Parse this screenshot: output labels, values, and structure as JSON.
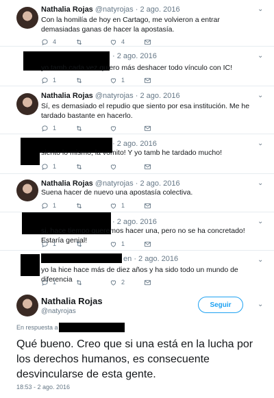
{
  "tweets": [
    {
      "name": "Nathalia Rojas",
      "handle": "@natyrojas",
      "date": "2 ago. 2016",
      "text": "Con la homilía de hoy en Cartago, me volvieron a entrar demasiadas ganas de hacer la apostasía.",
      "replies": "4",
      "retweets": "",
      "likes": "4"
    },
    {
      "name": "",
      "handle": "",
      "date": "2 ago. 2016",
      "text": "yo tamb cada vez quiero más deshacer todo vínculo con IC!",
      "replies": "1",
      "retweets": "",
      "likes": "1"
    },
    {
      "name": "Nathalia Rojas",
      "handle": "@natyrojas",
      "date": "2 ago. 2016",
      "text": "Sí, es demasiado el repudio que siento por esa institución. Me he tardado bastante en hacerlo.",
      "replies": "1",
      "retweets": "",
      "likes": ""
    },
    {
      "name": "",
      "handle": "",
      "date": "2 ago. 2016",
      "text": "siento lo mismo, la vomito! Y yo tamb he tardado mucho!",
      "replies": "1",
      "retweets": "",
      "likes": ""
    },
    {
      "name": "Nathalia Rojas",
      "handle": "@natyrojas",
      "date": "2 ago. 2016",
      "text": "Suena hacer de nuevo una apostasía colectiva.",
      "replies": "1",
      "retweets": "",
      "likes": "1"
    },
    {
      "name": "",
      "handle": "",
      "date": "2 ago. 2016",
      "text": "si, hace tiempo queremos hacer una, pero no se ha concretado! Estaría genial!",
      "replies": "1",
      "retweets": "",
      "likes": "1"
    },
    {
      "name": "",
      "handle": "",
      "date": "2 ago. 2016",
      "handle_suffix": "en",
      "text": "yo la hice hace más de diez años y ha sido todo un mundo de diferencia",
      "replies": "1",
      "retweets": "",
      "likes": "2"
    }
  ],
  "main_tweet": {
    "name": "Nathalia Rojas",
    "handle": "@natyrojas",
    "follow_label": "Seguir",
    "reply_to_label": "En respuesta a",
    "text": "Qué bueno. Creo que si una está en la lucha por los derechos humanos, es consecuente desvincularse de esta gente.",
    "timestamp": "18:53 - 2 ago. 2016"
  },
  "colors": {
    "accent": "#1da1f2",
    "muted": "#657786",
    "divider": "#e6ecf0"
  }
}
